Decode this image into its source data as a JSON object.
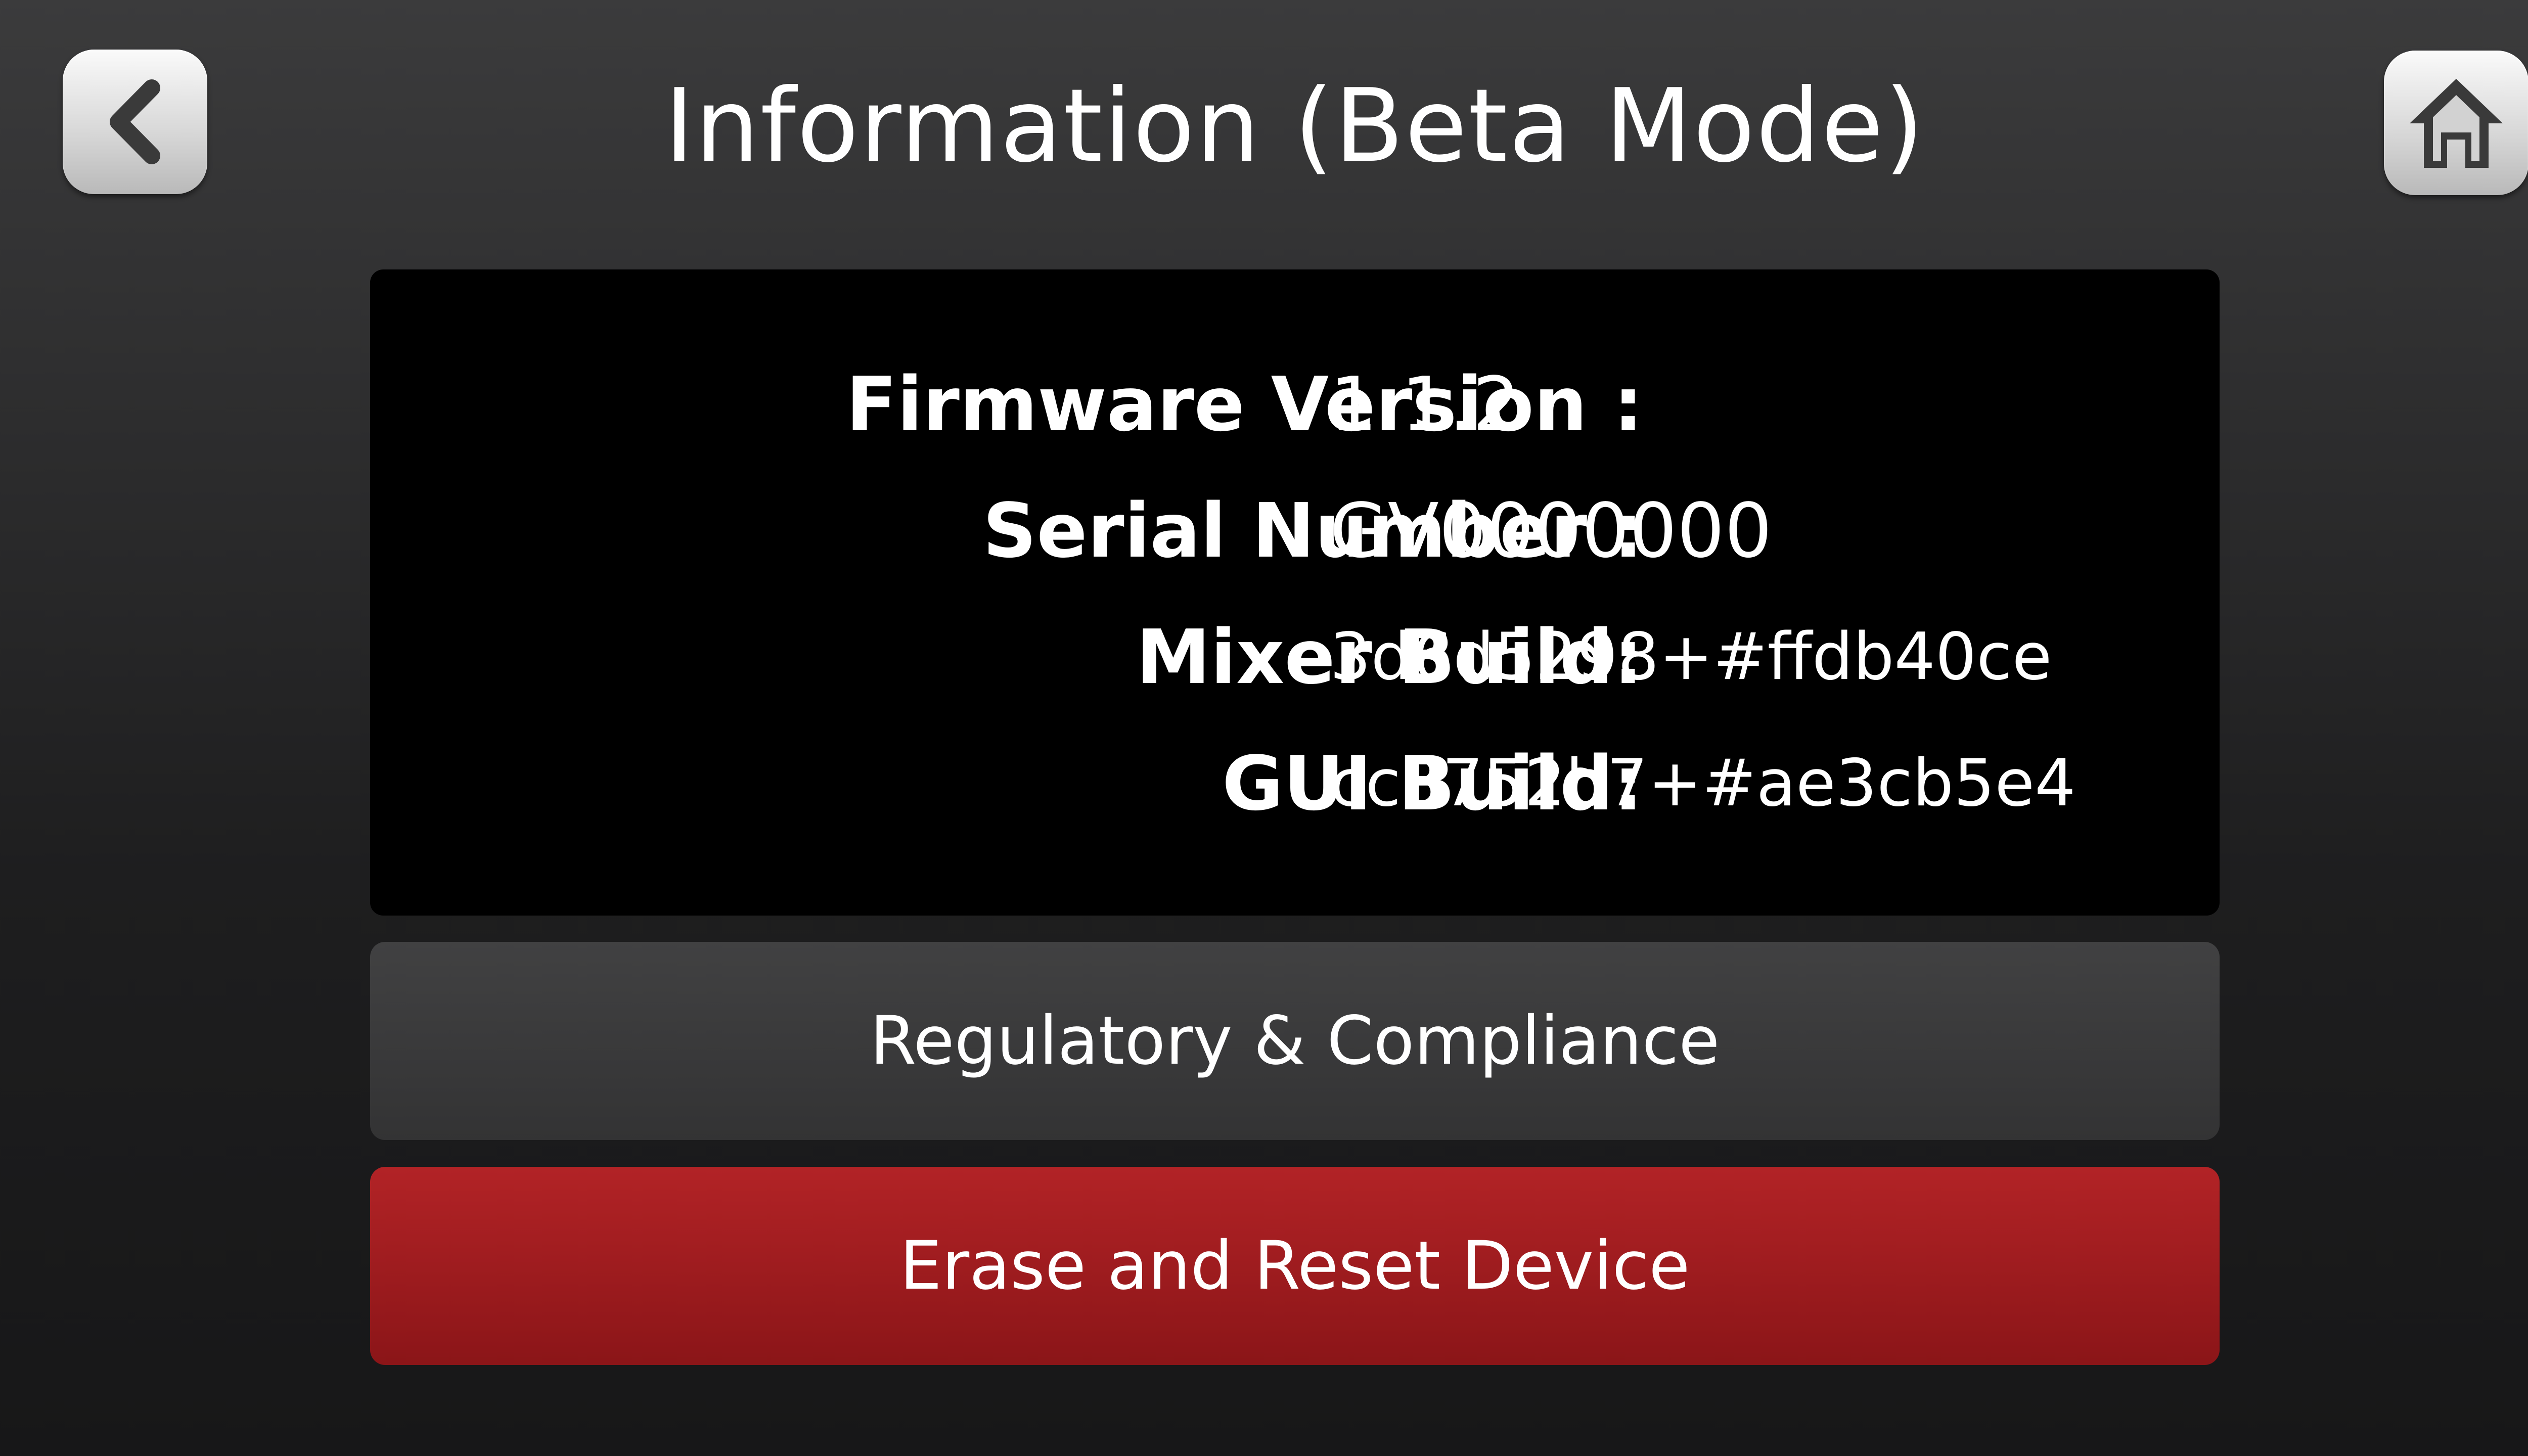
{
  "header": {
    "title": "Information (Beta Mode)",
    "back_icon": "chevron-left-icon",
    "home_icon": "home-icon"
  },
  "info": {
    "firmware_label": "Firmware Version :",
    "firmware_value": "1.1.2",
    "serial_label": "Serial Number :",
    "serial_value": "GV0000000",
    "mixer_label": "Mixer Build:",
    "mixer_value": "3d6d5298+#ffdb40ce",
    "gui_label": "GUI Build:",
    "gui_value": "cc3752b7+#ae3cb5e4"
  },
  "actions": {
    "regulatory_label": "Regulatory & Compliance",
    "erase_label": "Erase and Reset Device"
  },
  "colors": {
    "background": "#2a2a2b",
    "panel": "#000000",
    "button_gray": "#3a3a3b",
    "button_red": "#a01c1f",
    "icon_button": "#d9d9d9",
    "icon_glyph": "#3a3a3a"
  }
}
